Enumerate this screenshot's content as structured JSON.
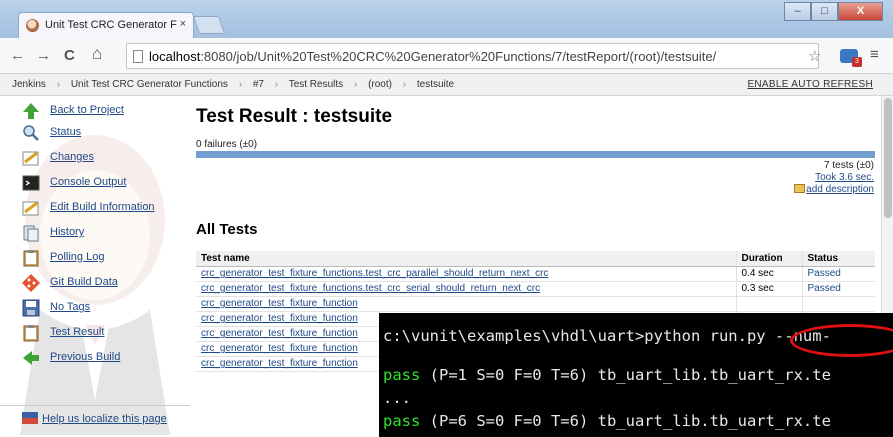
{
  "browser": {
    "tab_title": "Unit Test CRC Generator F",
    "tab_close": "×",
    "window_min": "–",
    "window_max": "□",
    "window_close": "X",
    "back": "←",
    "forward": "→",
    "reload": "C",
    "home": "⌂",
    "url_host": "localhost",
    "url_path": ":8080/job/Unit%20Test%20CRC%20Generator%20Functions/7/testReport/(root)/testsuite/",
    "star": "☆",
    "menu": "≡",
    "ext_badge": "3"
  },
  "breadcrumb": {
    "items": [
      "Jenkins",
      "Unit Test CRC Generator Functions",
      "#7",
      "Test Results",
      "(root)",
      "testsuite"
    ],
    "separator": "›",
    "auto_refresh": "ENABLE AUTO REFRESH"
  },
  "sidebar": {
    "items": [
      {
        "label": "Back to Project",
        "icon": "up-arrow-icon"
      },
      {
        "label": "Status",
        "icon": "magnifier-icon"
      },
      {
        "label": "Changes",
        "icon": "notepad-icon"
      },
      {
        "label": "Console Output",
        "icon": "terminal-icon"
      },
      {
        "label": "Edit Build Information",
        "icon": "notepad-icon"
      },
      {
        "label": "History",
        "icon": "history-icon"
      },
      {
        "label": "Polling Log",
        "icon": "clipboard-icon"
      },
      {
        "label": "Git Build Data",
        "icon": "git-icon"
      },
      {
        "label": "No Tags",
        "icon": "save-icon"
      },
      {
        "label": "Test Result",
        "icon": "clipboard-icon"
      },
      {
        "label": "Previous Build",
        "icon": "left-arrow-icon"
      }
    ],
    "localize": "Help us localize this page"
  },
  "main": {
    "title": "Test Result : testsuite",
    "failures": "0 failures (±0)",
    "progress_fraction": 1.0,
    "tests_count": "7 tests (±0)",
    "took": "Took 3.6 sec.",
    "add_description": "add description",
    "section_title": "All Tests",
    "table": {
      "headers": [
        "Test name",
        "Duration",
        "Status"
      ],
      "rows": [
        {
          "name": "crc_generator_test_fixture_functions.test_crc_parallel_should_return_next_crc",
          "duration": "0.4 sec",
          "status": "Passed"
        },
        {
          "name": "crc_generator_test_fixture_functions.test_crc_serial_should_return_next_crc",
          "duration": "0.3 sec",
          "status": "Passed"
        },
        {
          "name": "crc_generator_test_fixture_function",
          "duration": "",
          "status": ""
        },
        {
          "name": "crc_generator_test_fixture_function",
          "duration": "",
          "status": ""
        },
        {
          "name": "crc_generator_test_fixture_function",
          "duration": "",
          "status": ""
        },
        {
          "name": "crc_generator_test_fixture_function",
          "duration": "",
          "status": ""
        },
        {
          "name": "crc_generator_test_fixture_function",
          "duration": "",
          "status": ""
        }
      ]
    }
  },
  "console": {
    "command": "c:\\vunit\\examples\\vhdl\\uart>python run.py --num-",
    "line1_pass": "pass",
    "line1_rest": " (P=1 S=0 F=0 T=6) tb_uart_lib.tb_uart_rx.te",
    "line2": "...",
    "line3_pass": "pass",
    "line3_rest": " (P=6 S=0 F=0 T=6) tb_uart_lib.tb_uart_rx.te"
  },
  "colors": {
    "link": "#204a87",
    "progress": "#729fcf",
    "pass_green": "#2ee32e",
    "highlight_red": "#e01010"
  }
}
